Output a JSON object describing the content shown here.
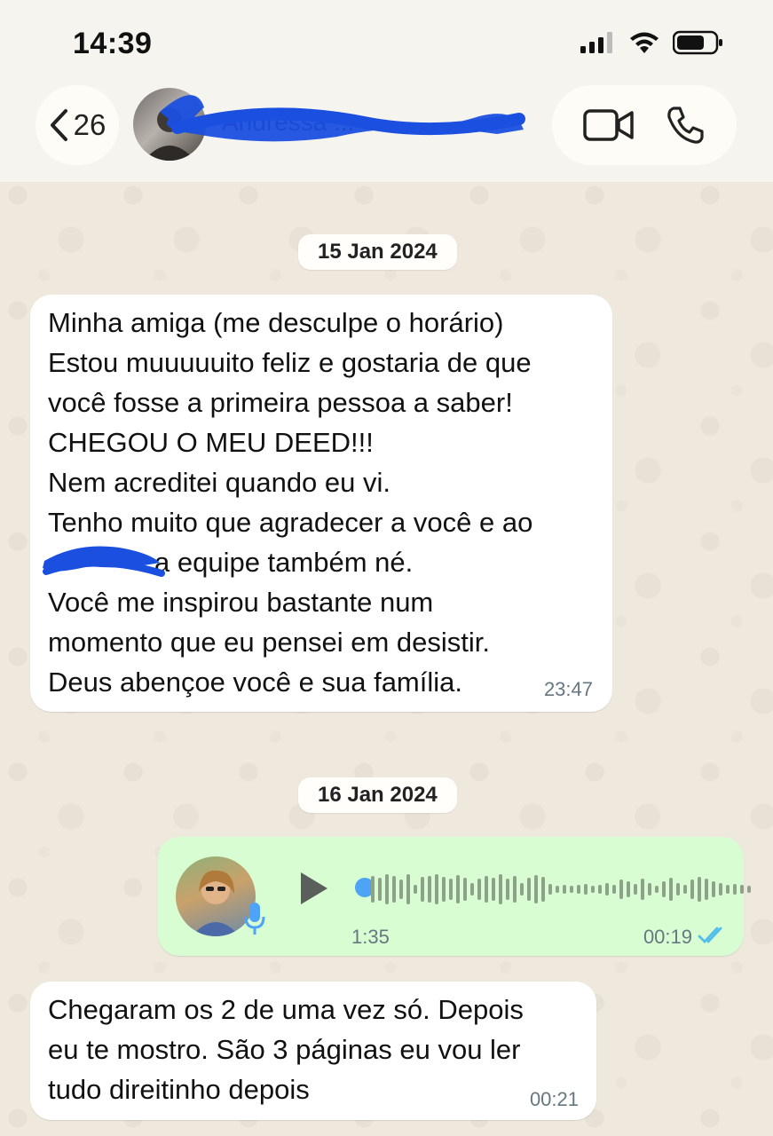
{
  "status_bar": {
    "time": "14:39"
  },
  "header": {
    "back_count": "26",
    "contact_name": "Andressa ..."
  },
  "messages": [
    {
      "date": "15 Jan 2024",
      "direction": "incoming",
      "lines": [
        "Minha amiga (me desculpe o horário)",
        "Estou muuuuuito feliz e gostaria de que",
        "você fosse a primeira pessoa a saber!",
        "CHEGOU O MEU DEED!!!",
        "Nem acreditei quando eu vi.",
        "Tenho muito que agradecer a você e ao",
        "a equipe também né.",
        "Você me inspirou bastante num",
        "momento que eu pensei em desistir.",
        "Deus abençoe você e sua família."
      ],
      "time": "23:47"
    },
    {
      "date": "16 Jan 2024",
      "direction": "outgoing",
      "type": "voice",
      "duration": "1:35",
      "time": "00:19",
      "status": "read"
    },
    {
      "direction": "incoming",
      "lines": [
        "Chegaram os 2 de uma vez só. Depois",
        "eu te mostro. São 3 páginas eu vou ler",
        "tudo direitinho depois"
      ],
      "time": "00:21"
    }
  ],
  "icons": {
    "back": "chevron-left-icon",
    "video": "video-camera-icon",
    "phone": "phone-icon",
    "play": "play-icon",
    "mic": "microphone-icon",
    "read": "double-check-icon"
  },
  "colors": {
    "outgoing_bubble": "#d9fdd3",
    "incoming_bubble": "#ffffff",
    "read_ticks": "#53bdeb",
    "voice_dot": "#4da3f5"
  }
}
